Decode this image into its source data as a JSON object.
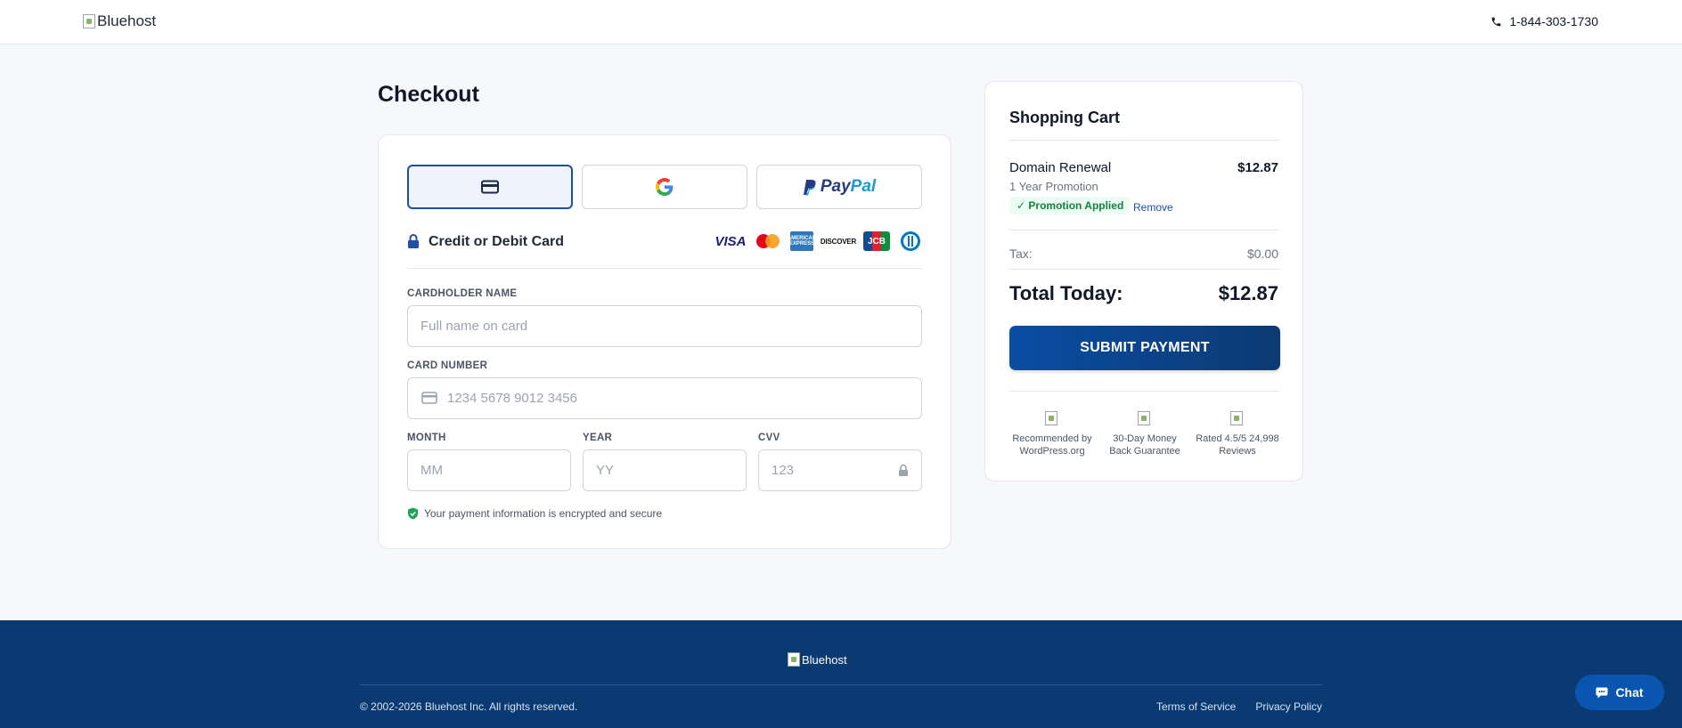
{
  "header": {
    "logo_alt": "Bluehost",
    "phone": "1-844-303-1730"
  },
  "checkout": {
    "title": "Checkout",
    "methods": [
      "card-icon",
      "google-icon",
      "PayPal"
    ],
    "paypal": {
      "pay": "Pay",
      "pal": "Pal"
    },
    "card_heading": "Credit or Debit Card",
    "brands": {
      "visa": "VISA",
      "amex": "AMERICAN EXPRESS",
      "discover": "DISCOVER",
      "jcb": "JCB"
    },
    "fields": {
      "cardholder_label": "CARDHOLDER NAME",
      "cardholder_placeholder": "Full name on card",
      "card_number_label": "CARD NUMBER",
      "card_number_placeholder": "1234 5678 9012 3456",
      "month_label": "MONTH",
      "month_placeholder": "MM",
      "year_label": "YEAR",
      "year_placeholder": "YY",
      "cvv_label": "CVV",
      "cvv_placeholder": "123"
    },
    "secure_note": "Your payment information is encrypted and secure"
  },
  "cart": {
    "title": "Shopping Cart",
    "item": {
      "name": "Domain Renewal",
      "price": "$12.87",
      "subtitle": "1 Year Promotion",
      "promo": "✓ Promotion Applied",
      "remove": "Remove"
    },
    "tax_label": "Tax:",
    "tax_value": "$0.00",
    "total_label": "Total Today:",
    "total_value": "$12.87",
    "submit": "SUBMIT PAYMENT",
    "trust": [
      "Recommended by WordPress.org",
      "30-Day Money Back Guarantee",
      "Rated 4.5/5 24,998 Reviews"
    ]
  },
  "footer": {
    "logo_alt": "Bluehost",
    "copyright": "© 2002-2026 Bluehost Inc. All rights reserved.",
    "links": [
      "Terms of Service",
      "Privacy Policy"
    ]
  },
  "chat": {
    "label": "Chat"
  },
  "colors": {
    "primary": "#1d4fa8",
    "footer_bg": "#0b3a73",
    "promo_green": "#15803d"
  }
}
